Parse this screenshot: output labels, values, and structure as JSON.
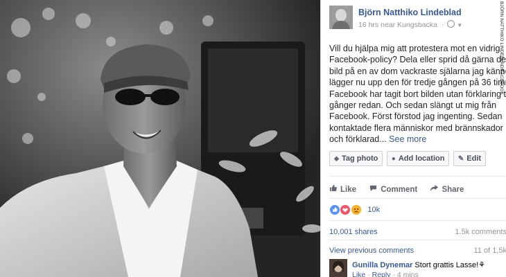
{
  "post": {
    "author": "Björn Natthiko Lindeblad",
    "time": "16 hrs",
    "location": "near Kungsbacka",
    "dot": "·",
    "credit": "BJÖRN NATTHIKO LINDEBLAD/FACEBOOK",
    "text": "Vill du hjälpa mig att protestera mot en vidrig\nFacebook-policy? Dela eller sprid då gärna den\nbild på en av dom vackraste själarna jag känner.\nlägger nu upp den för tredje gången på 36 timmar.\nFacebook har tagit bort bilden utan förklaring två\ngånger redan. Och sedan slängt ut mig från\nFacebook. Först förstod jag ingenting. Sedan\nkontaktade flera människor med brännskador mig\noch förklarad...",
    "see_more": "See more"
  },
  "photo_buttons": [
    {
      "icon": "tag-icon",
      "glyph": "⬥",
      "label": "Tag photo"
    },
    {
      "icon": "location-pin-icon",
      "glyph": "●",
      "label": "Add location"
    },
    {
      "icon": "pencil-icon",
      "glyph": "✎",
      "label": "Edit"
    }
  ],
  "actions": {
    "like": "Like",
    "comment": "Comment",
    "share": "Share"
  },
  "reactions": {
    "count": "10k",
    "colors": {
      "like": "#5890ff",
      "love": "#f25268",
      "sad": "#f7b125"
    }
  },
  "stats": {
    "shares": "10,001 shares",
    "comments": "1.5k comments"
  },
  "comments_section": {
    "view_previous": "View previous comments",
    "count": "11 of 1,5k"
  },
  "comment": {
    "name": "Gunilla Dynemar",
    "text": "Stort grattis Lasse!",
    "emoji": "⚘",
    "like": "Like",
    "reply": "Reply",
    "time": "4 mins",
    "sep": "·"
  }
}
